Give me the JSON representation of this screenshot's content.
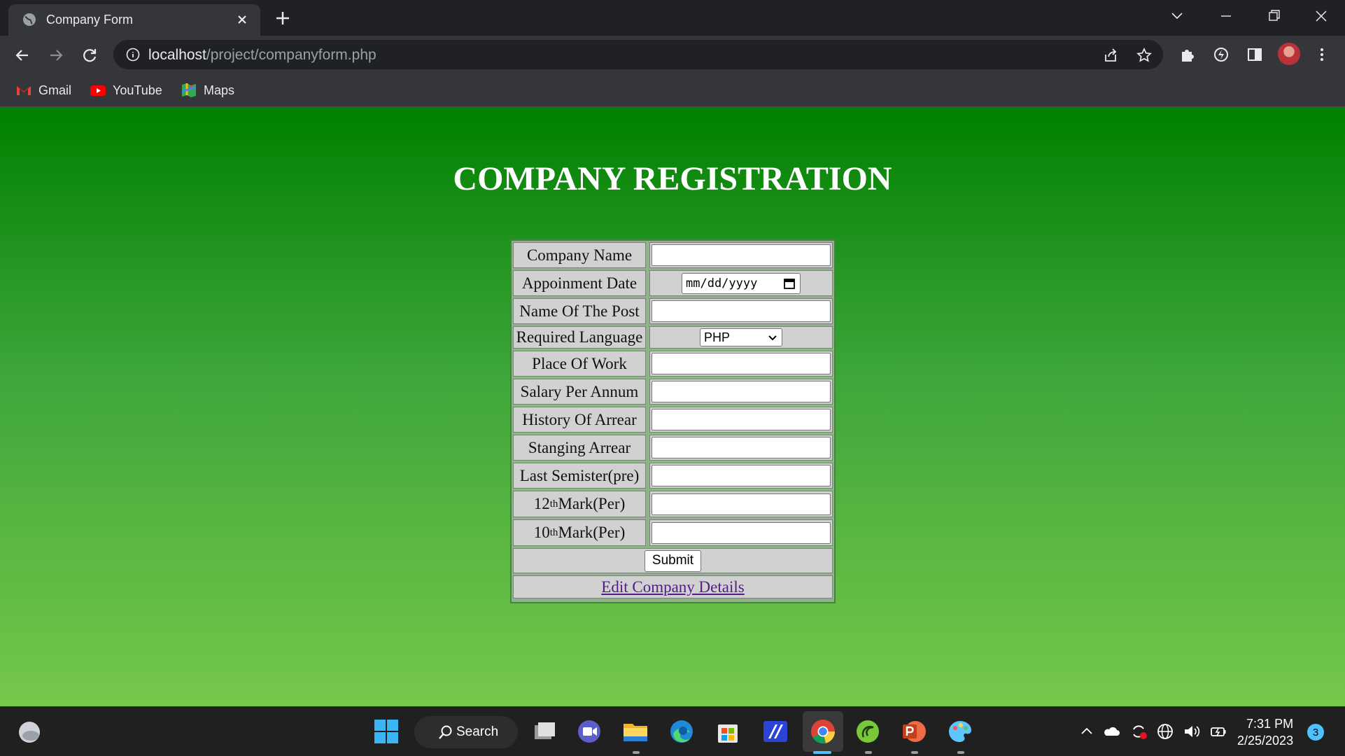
{
  "browser": {
    "tab_title": "Company Form",
    "url_host": "localhost",
    "url_path": "/project/companyform.php",
    "bookmarks": [
      {
        "label": "Gmail",
        "icon": "gmail-icon"
      },
      {
        "label": "YouTube",
        "icon": "youtube-icon"
      },
      {
        "label": "Maps",
        "icon": "maps-icon"
      }
    ]
  },
  "page": {
    "heading": "COMPANY REGISTRATION",
    "fields": {
      "company_name": "Company Name",
      "appointment_date": "Appoinment Date",
      "date_placeholder": "mm/dd/yyyy",
      "post_name": "Name Of The Post",
      "required_language": "Required Language",
      "language_selected": "PHP",
      "place_of_work": "Place Of Work",
      "salary": "Salary Per Annum",
      "history_arrear": "History Of Arrear",
      "standing_arrear": "Stanging Arrear",
      "last_semester": "Last Semister(pre)",
      "mark12_num": "12",
      "mark12_sup": "th",
      "mark12_rest": "Mark(Per)",
      "mark10_num": "10",
      "mark10_sup": "th",
      "mark10_rest": "Mark(Per)"
    },
    "submit_label": "Submit",
    "edit_link": "Edit Company Details"
  },
  "taskbar": {
    "search_label": "Search",
    "time": "7:31 PM",
    "date": "2/25/2023",
    "notification_count": "3"
  },
  "colors": {
    "page_top": "#008000",
    "page_bottom": "#75c84a",
    "link": "#551a8b"
  }
}
